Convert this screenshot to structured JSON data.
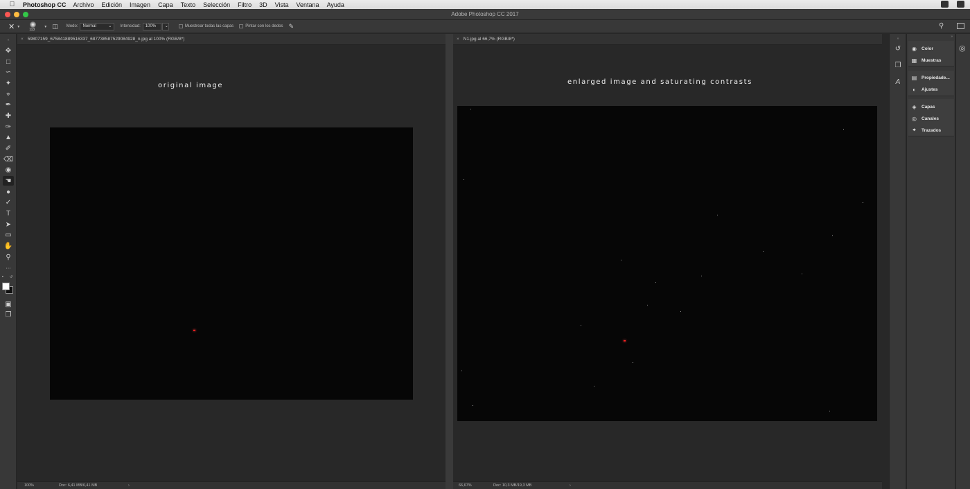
{
  "menubar": {
    "app_name": "Photoshop CC",
    "items": [
      "Archivo",
      "Edición",
      "Imagen",
      "Capa",
      "Texto",
      "Selección",
      "Filtro",
      "3D",
      "Vista",
      "Ventana",
      "Ayuda"
    ]
  },
  "window": {
    "title": "Adobe Photoshop CC 2017"
  },
  "options": {
    "brush_size": "113",
    "mode_label": "Modo:",
    "mode_value": "Normal",
    "intensity_label": "Intensidad:",
    "intensity_value": "100%",
    "sample_all_layers": "Muestrear todas las capas",
    "finger_paint": "Pintar con los dedos"
  },
  "documents": [
    {
      "tab_title": "59807159_675841889516337_687738587529084928_n.jpg al 100% (RGB/8*)",
      "caption": "original image",
      "zoom": "100%",
      "doc_size": "Doc: 6,41 MB/6,41 MB"
    },
    {
      "tab_title": "N1.jpg al 66,7% (RGB/8*)",
      "caption": "enlarged image and saturating contrasts",
      "zoom": "66,67%",
      "doc_size": "Doc: 10,3 MB/19,3 MB"
    }
  ],
  "panels": {
    "group1": [
      "Color",
      "Muestras"
    ],
    "group2": [
      "Propiedade...",
      "Ajustes"
    ],
    "group3": [
      "Capas",
      "Canales",
      "Trazados"
    ]
  },
  "colors": {
    "traffic_red": "#fc5753",
    "traffic_yellow": "#fdbc40",
    "traffic_green": "#33c748"
  }
}
